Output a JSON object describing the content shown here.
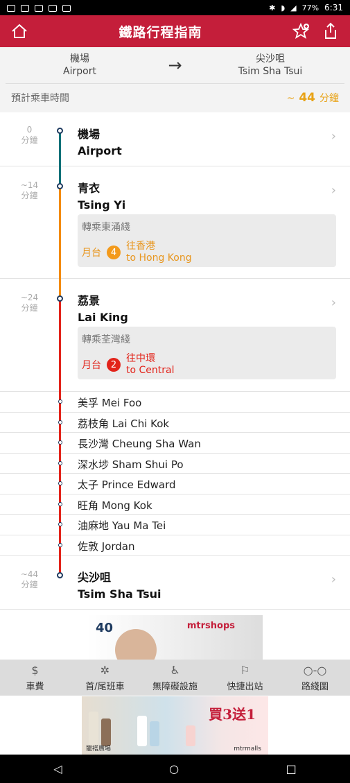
{
  "status_bar": {
    "battery": "77%",
    "time": "6:31"
  },
  "header": {
    "title": "鐵路行程指南"
  },
  "route": {
    "from_zh": "機場",
    "from_en": "Airport",
    "to_zh": "尖沙咀",
    "to_en": "Tsim Sha Tsui",
    "arrow": "→"
  },
  "trip_time": {
    "label": "預計乘車時間",
    "prefix": "~",
    "minutes": "44",
    "unit": "分鐘"
  },
  "stops": [
    {
      "mins": "0",
      "unit": "分鐘",
      "zh": "機場",
      "en": "Airport"
    },
    {
      "mins": "~14",
      "unit": "分鐘",
      "zh": "青衣",
      "en": "Tsing Yi",
      "transfer": {
        "title": "轉乘東涌綫",
        "platform_label": "月台",
        "platform": "4",
        "dest_zh": "往香港",
        "dest_en": "to Hong Kong",
        "color": "#e8961e"
      }
    },
    {
      "mins": "~24",
      "unit": "分鐘",
      "zh": "荔景",
      "en": "Lai King",
      "transfer": {
        "title": "轉乘荃灣綫",
        "platform_label": "月台",
        "platform": "2",
        "dest_zh": "往中環",
        "dest_en": "to Central",
        "color": "#e2231a"
      }
    },
    {
      "mins": "~44",
      "unit": "分鐘",
      "zh": "尖沙咀",
      "en": "Tsim Sha Tsui"
    }
  ],
  "intermediate_stops": [
    "美孚 Mei Foo",
    "荔枝角 Lai Chi Kok",
    "長沙灣 Cheung Sha Wan",
    "深水埗 Sham Shui Po",
    "太子 Prince Edward",
    "旺角 Mong Kok",
    "油麻地 Yau Ma Tei",
    "佐敦 Jordan"
  ],
  "ad_top": {
    "anniv": "40",
    "brand": "mtrshops"
  },
  "tabs": [
    {
      "icon": "$",
      "label": "車費"
    },
    {
      "icon": "✲",
      "label": "首/尾班車"
    },
    {
      "icon": "♿",
      "label": "無障礙設施"
    },
    {
      "icon": "⚐",
      "label": "快捷出站"
    },
    {
      "icon": "○-○",
      "label": "路綫圖"
    }
  ],
  "ad_bottom": {
    "promo": "買3送1",
    "brand": "mtrmalls",
    "mall": "寵褡廣場"
  },
  "line_colors": {
    "airport": "#007078",
    "tung_chung": "#f38b00",
    "tsuen_wan": "#e2231a"
  }
}
